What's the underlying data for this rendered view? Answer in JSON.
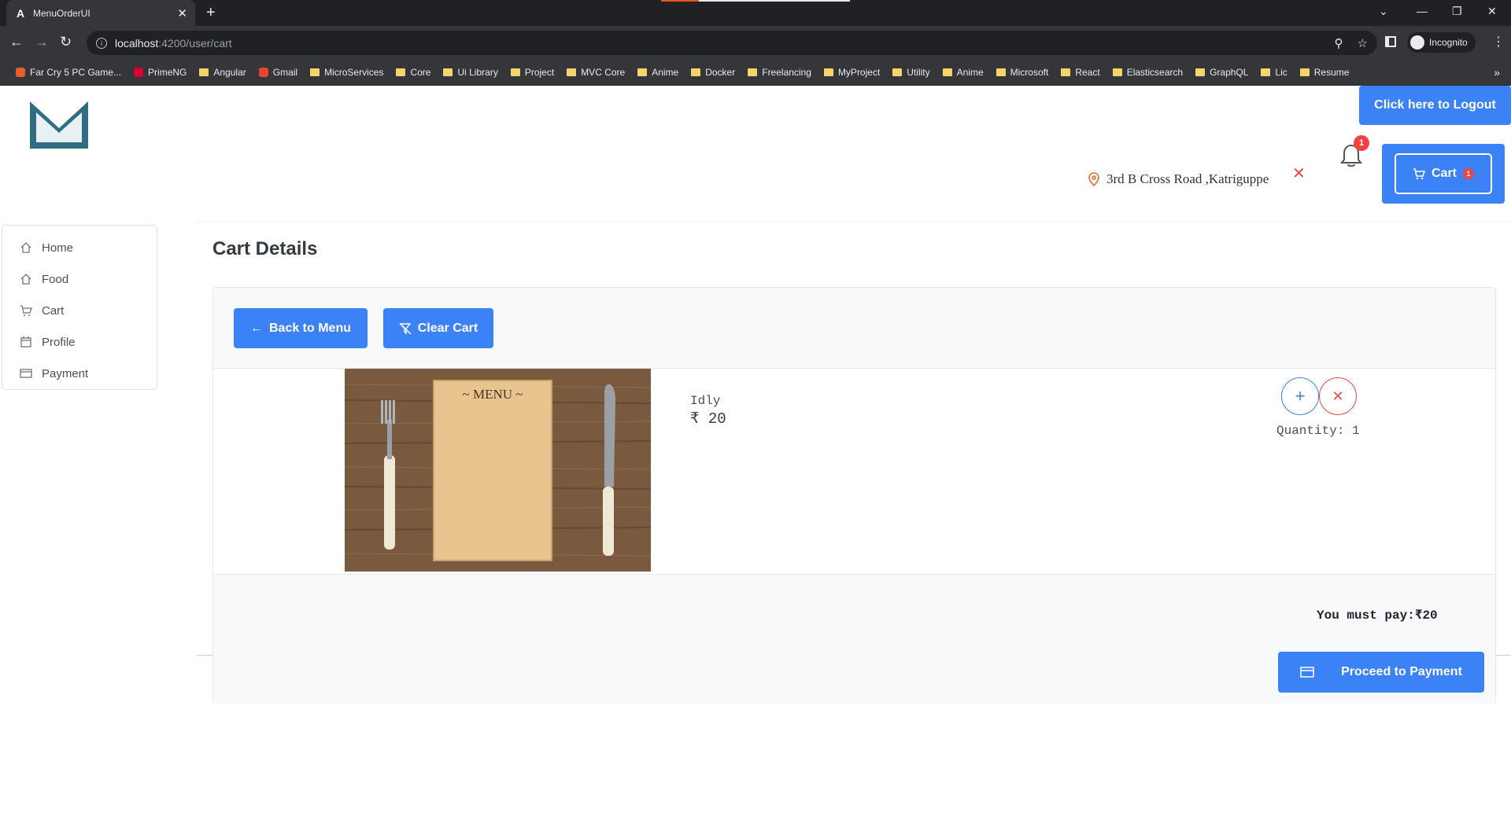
{
  "browser": {
    "tab_title": "MenuOrderUI",
    "url_host": "localhost",
    "url_path": ":4200/user/cart",
    "incognito_label": "Incognito",
    "bookmarks": [
      {
        "label": "Far Cry 5 PC Game...",
        "icon": "game-icon",
        "color": "#e85d2a"
      },
      {
        "label": "PrimeNG",
        "icon": "primeng-icon",
        "color": "#dd0031"
      },
      {
        "label": "Angular",
        "icon": "folder-icon",
        "color": "#f6d36b"
      },
      {
        "label": "Gmail",
        "icon": "gmail-icon",
        "color": "#ea4335"
      },
      {
        "label": "MicroServices",
        "icon": "folder-icon",
        "color": "#f6d36b"
      },
      {
        "label": "Core",
        "icon": "folder-icon",
        "color": "#f6d36b"
      },
      {
        "label": "Ui Library",
        "icon": "folder-icon",
        "color": "#f6d36b"
      },
      {
        "label": "Project",
        "icon": "folder-icon",
        "color": "#f6d36b"
      },
      {
        "label": "MVC Core",
        "icon": "folder-icon",
        "color": "#f6d36b"
      },
      {
        "label": "Anime",
        "icon": "folder-icon",
        "color": "#f6d36b"
      },
      {
        "label": "Docker",
        "icon": "folder-icon",
        "color": "#f6d36b"
      },
      {
        "label": "Freelancing",
        "icon": "folder-icon",
        "color": "#f6d36b"
      },
      {
        "label": "MyProject",
        "icon": "folder-icon",
        "color": "#f6d36b"
      },
      {
        "label": "Utility",
        "icon": "folder-icon",
        "color": "#f6d36b"
      },
      {
        "label": "Anime",
        "icon": "folder-icon",
        "color": "#f6d36b"
      },
      {
        "label": "Microsoft",
        "icon": "folder-icon",
        "color": "#f6d36b"
      },
      {
        "label": "React",
        "icon": "folder-icon",
        "color": "#f6d36b"
      },
      {
        "label": "Elasticsearch",
        "icon": "folder-icon",
        "color": "#f6d36b"
      },
      {
        "label": "GraphQL",
        "icon": "folder-icon",
        "color": "#f6d36b"
      },
      {
        "label": "Lic",
        "icon": "folder-icon",
        "color": "#f6d36b"
      },
      {
        "label": "Resume",
        "icon": "folder-icon",
        "color": "#f6d36b"
      }
    ]
  },
  "header": {
    "logout_label": "Click here to Logout",
    "location": "3rd B Cross Road ,Katriguppe",
    "notification_count": "1",
    "cart_label": "Cart",
    "cart_count": "1",
    "accent_color": "#3b82f6"
  },
  "sidebar": {
    "items": [
      {
        "label": "Home",
        "icon": "home-icon"
      },
      {
        "label": "Food",
        "icon": "home-icon"
      },
      {
        "label": "Cart",
        "icon": "cart-icon"
      },
      {
        "label": "Profile",
        "icon": "calendar-icon"
      },
      {
        "label": "Payment",
        "icon": "credit-card-icon"
      }
    ]
  },
  "main": {
    "title": "Cart Details",
    "back_label": "Back to Menu",
    "clear_label": "Clear Cart",
    "item": {
      "name": "Idly",
      "price": "₹ 20",
      "quantity": "Quantity: 1",
      "image_text": "~ MENU ~"
    },
    "total": "You must pay:₹20",
    "pay_label": "Proceed to Payment"
  }
}
